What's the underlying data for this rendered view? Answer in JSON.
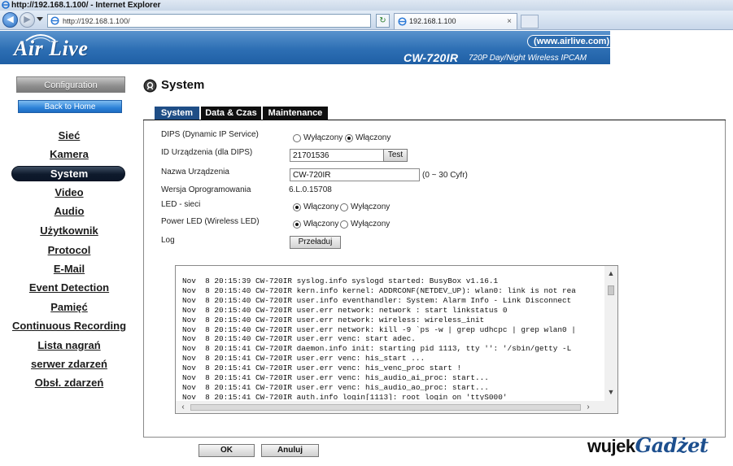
{
  "browser": {
    "window_title": "http://192.168.1.100/ - Internet Explorer",
    "address": "http://192.168.1.100/",
    "tab_title": "192.168.1.100",
    "tab_close": "×"
  },
  "banner": {
    "brand": "Air Live",
    "site_url": "(www.airlive.com)",
    "model": "CW-720IR",
    "model_desc": "720P Day/Night Wireless IPCAM",
    "background": "#2d6fb4"
  },
  "sidebar": {
    "configuration_label": "Configuration",
    "back_home_label": "Back to Home",
    "items": [
      {
        "label": "Sieć",
        "active": false
      },
      {
        "label": "Kamera",
        "active": false
      },
      {
        "label": "System",
        "active": true
      },
      {
        "label": "Video",
        "active": false
      },
      {
        "label": "Audio",
        "active": false
      },
      {
        "label": "Użytkownik",
        "active": false
      },
      {
        "label": "Protocol",
        "active": false
      },
      {
        "label": "E-Mail",
        "active": false
      },
      {
        "label": "Event Detection",
        "active": false
      },
      {
        "label": "Pamięć",
        "active": false
      },
      {
        "label": "Continuous Recording",
        "active": false
      },
      {
        "label": "Lista nagrań",
        "active": false
      },
      {
        "label": "serwer zdarzeń",
        "active": false
      },
      {
        "label": "Obsł. zdarzeń",
        "active": false
      }
    ]
  },
  "page": {
    "title": "System",
    "tabs": [
      "System",
      "Data & Czas",
      "Maintenance"
    ],
    "active_tab": "System",
    "accent": "#1f4e86"
  },
  "form": {
    "dips": {
      "label": "DIPS (Dynamic IP Service)",
      "option_off": "Wyłączony",
      "option_on": "Włączony",
      "selected": "Włączony"
    },
    "device_id": {
      "label": "ID Urządzenia (dla DIPS)",
      "value": "21701536",
      "test_button": "Test"
    },
    "device_name": {
      "label": "Nazwa Urządzenia",
      "value": "CW-720IR",
      "hint": "(0 ~ 30 Cyfr)"
    },
    "firmware": {
      "label": "Wersja Oprogramowania",
      "value": "6.L.0.15708"
    },
    "led_net": {
      "label": "LED - sieci",
      "option_on": "Włączony",
      "option_off": "Wyłączony",
      "selected": "Włączony"
    },
    "power_led": {
      "label": "Power LED (Wireless LED)",
      "option_on": "Włączony",
      "option_off": "Wyłączony",
      "selected": "Włączony"
    },
    "log": {
      "label": "Log",
      "reload_button": "Przeładuj"
    }
  },
  "log_lines": [
    "Nov  8 20:15:39 CW-720IR syslog.info syslogd started: BusyBox v1.16.1",
    "Nov  8 20:15:40 CW-720IR kern.info kernel: ADDRCONF(NETDEV_UP): wlan0: link is not rea",
    "Nov  8 20:15:40 CW-720IR user.info eventhandler: System: Alarm Info - Link Disconnect",
    "Nov  8 20:15:40 CW-720IR user.err network: network : start linkstatus 0",
    "Nov  8 20:15:40 CW-720IR user.err network: wireless: wireless_init",
    "Nov  8 20:15:40 CW-720IR user.err network: kill -9 `ps -w | grep udhcpc | grep wlan0 |",
    "Nov  8 20:15:40 CW-720IR user.err venc: start adec.",
    "Nov  8 20:15:41 CW-720IR daemon.info init: starting pid 1113, tty '': '/sbin/getty -L",
    "Nov  8 20:15:41 CW-720IR user.err venc: his_start ...",
    "Nov  8 20:15:41 CW-720IR user.err venc: his_venc_proc start !",
    "Nov  8 20:15:41 CW-720IR user.err venc: his_audio_ai_proc: start...",
    "Nov  8 20:15:41 CW-720IR user.err venc: his_audio_ao_proc: start...",
    "Nov  8 20:15:41 CW-720IR auth.info login[1113]: root login on 'ttyS000'"
  ],
  "buttons": {
    "ok": "OK",
    "cancel": "Anuluj"
  },
  "watermark": {
    "part1": "wujek",
    "part2": "Gadżet"
  },
  "icons": {
    "browser": "ie-icon",
    "back": "back-arrow-icon",
    "forward": "forward-arrow-icon",
    "page": "page-icon",
    "search": "search-icon",
    "refresh": "refresh-icon",
    "title": "gear-icon"
  }
}
